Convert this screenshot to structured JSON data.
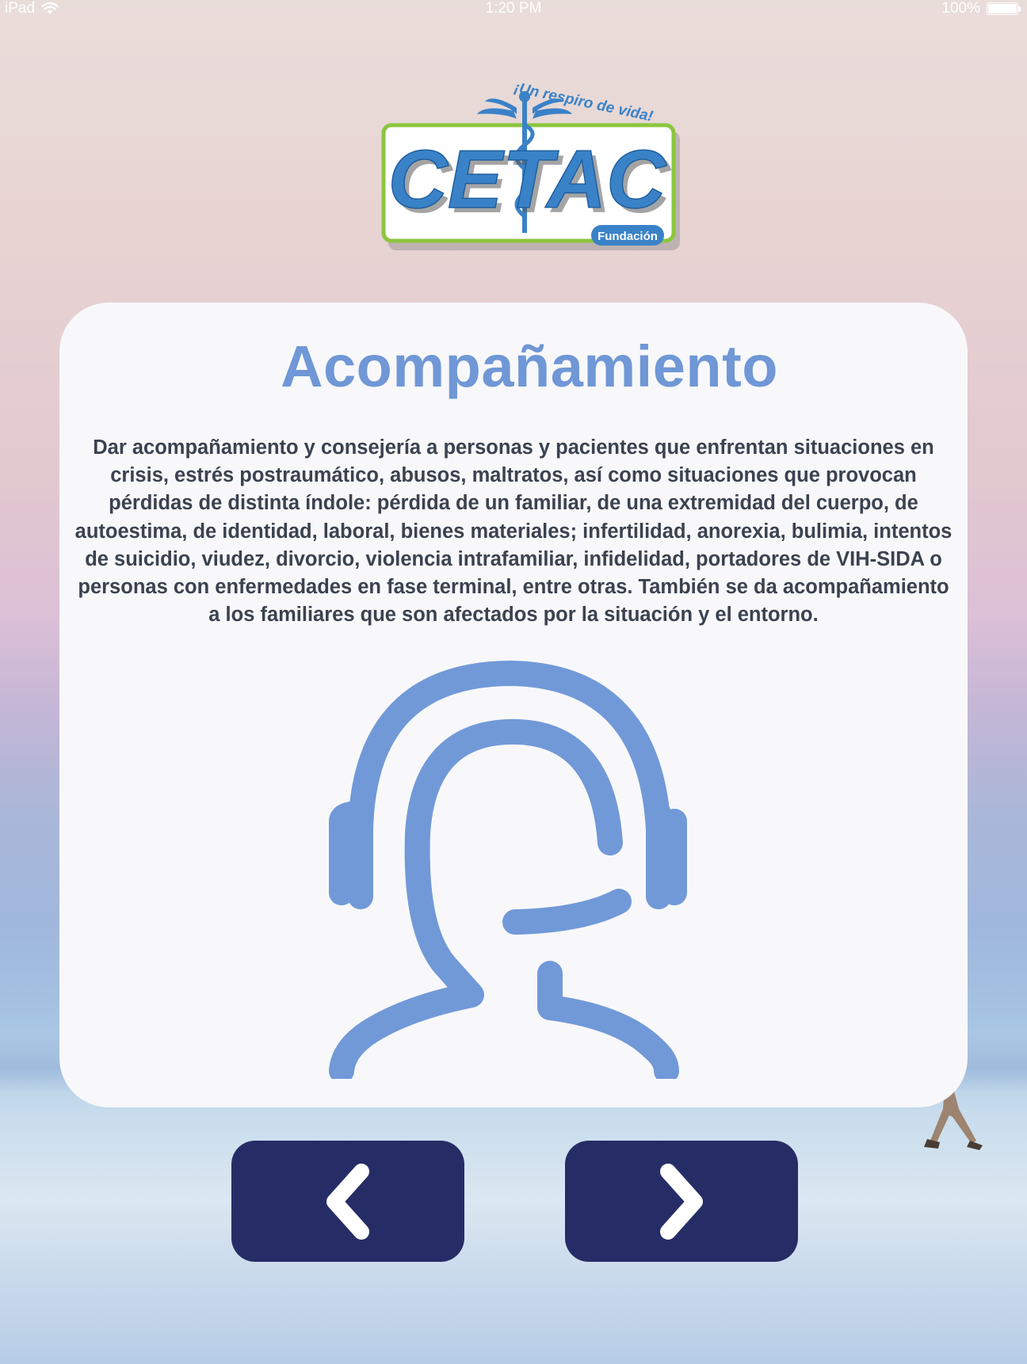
{
  "status_bar": {
    "device": "iPad",
    "time": "1:20 PM",
    "battery": "100%",
    "battery_level": 1.0,
    "icons": [
      "wifi-icon",
      "battery-icon"
    ]
  },
  "logo": {
    "tagline": "¡Un respiro de vida!",
    "name": "CETAC",
    "subtitle": "Fundación",
    "icon": "caduceus-icon"
  },
  "card": {
    "title": "Acompañamiento",
    "body": "Dar acompañamiento y consejería a personas y pacientes que enfrentan situaciones en crisis, estrés postraumático, abusos, maltratos, así como situaciones que provocan pérdidas de distinta índole: pérdida de un familiar, de una extremidad del cuerpo, de autoestima, de identidad, laboral, bienes materiales; infertilidad, anorexia, bulimia, intentos de suicidio, viudez, divorcio, violencia intrafamiliar, infidelidad, portadores de VIH-SIDA o personas con enfermedades en fase terminal, entre otras. También se da acompañamiento a los familiares que son afectados por la situación y el entorno.",
    "icon": "headset-support-icon"
  },
  "navigation": {
    "prev_icon": "chevron-left-icon",
    "next_icon": "chevron-right-icon"
  },
  "colors": {
    "accent": "#7097d6",
    "button": "#262d66",
    "card_bg": "#f8f8fa",
    "body_text": "#3b4250",
    "logo_blue": "#3a82c8",
    "logo_green": "#8cc63f"
  }
}
